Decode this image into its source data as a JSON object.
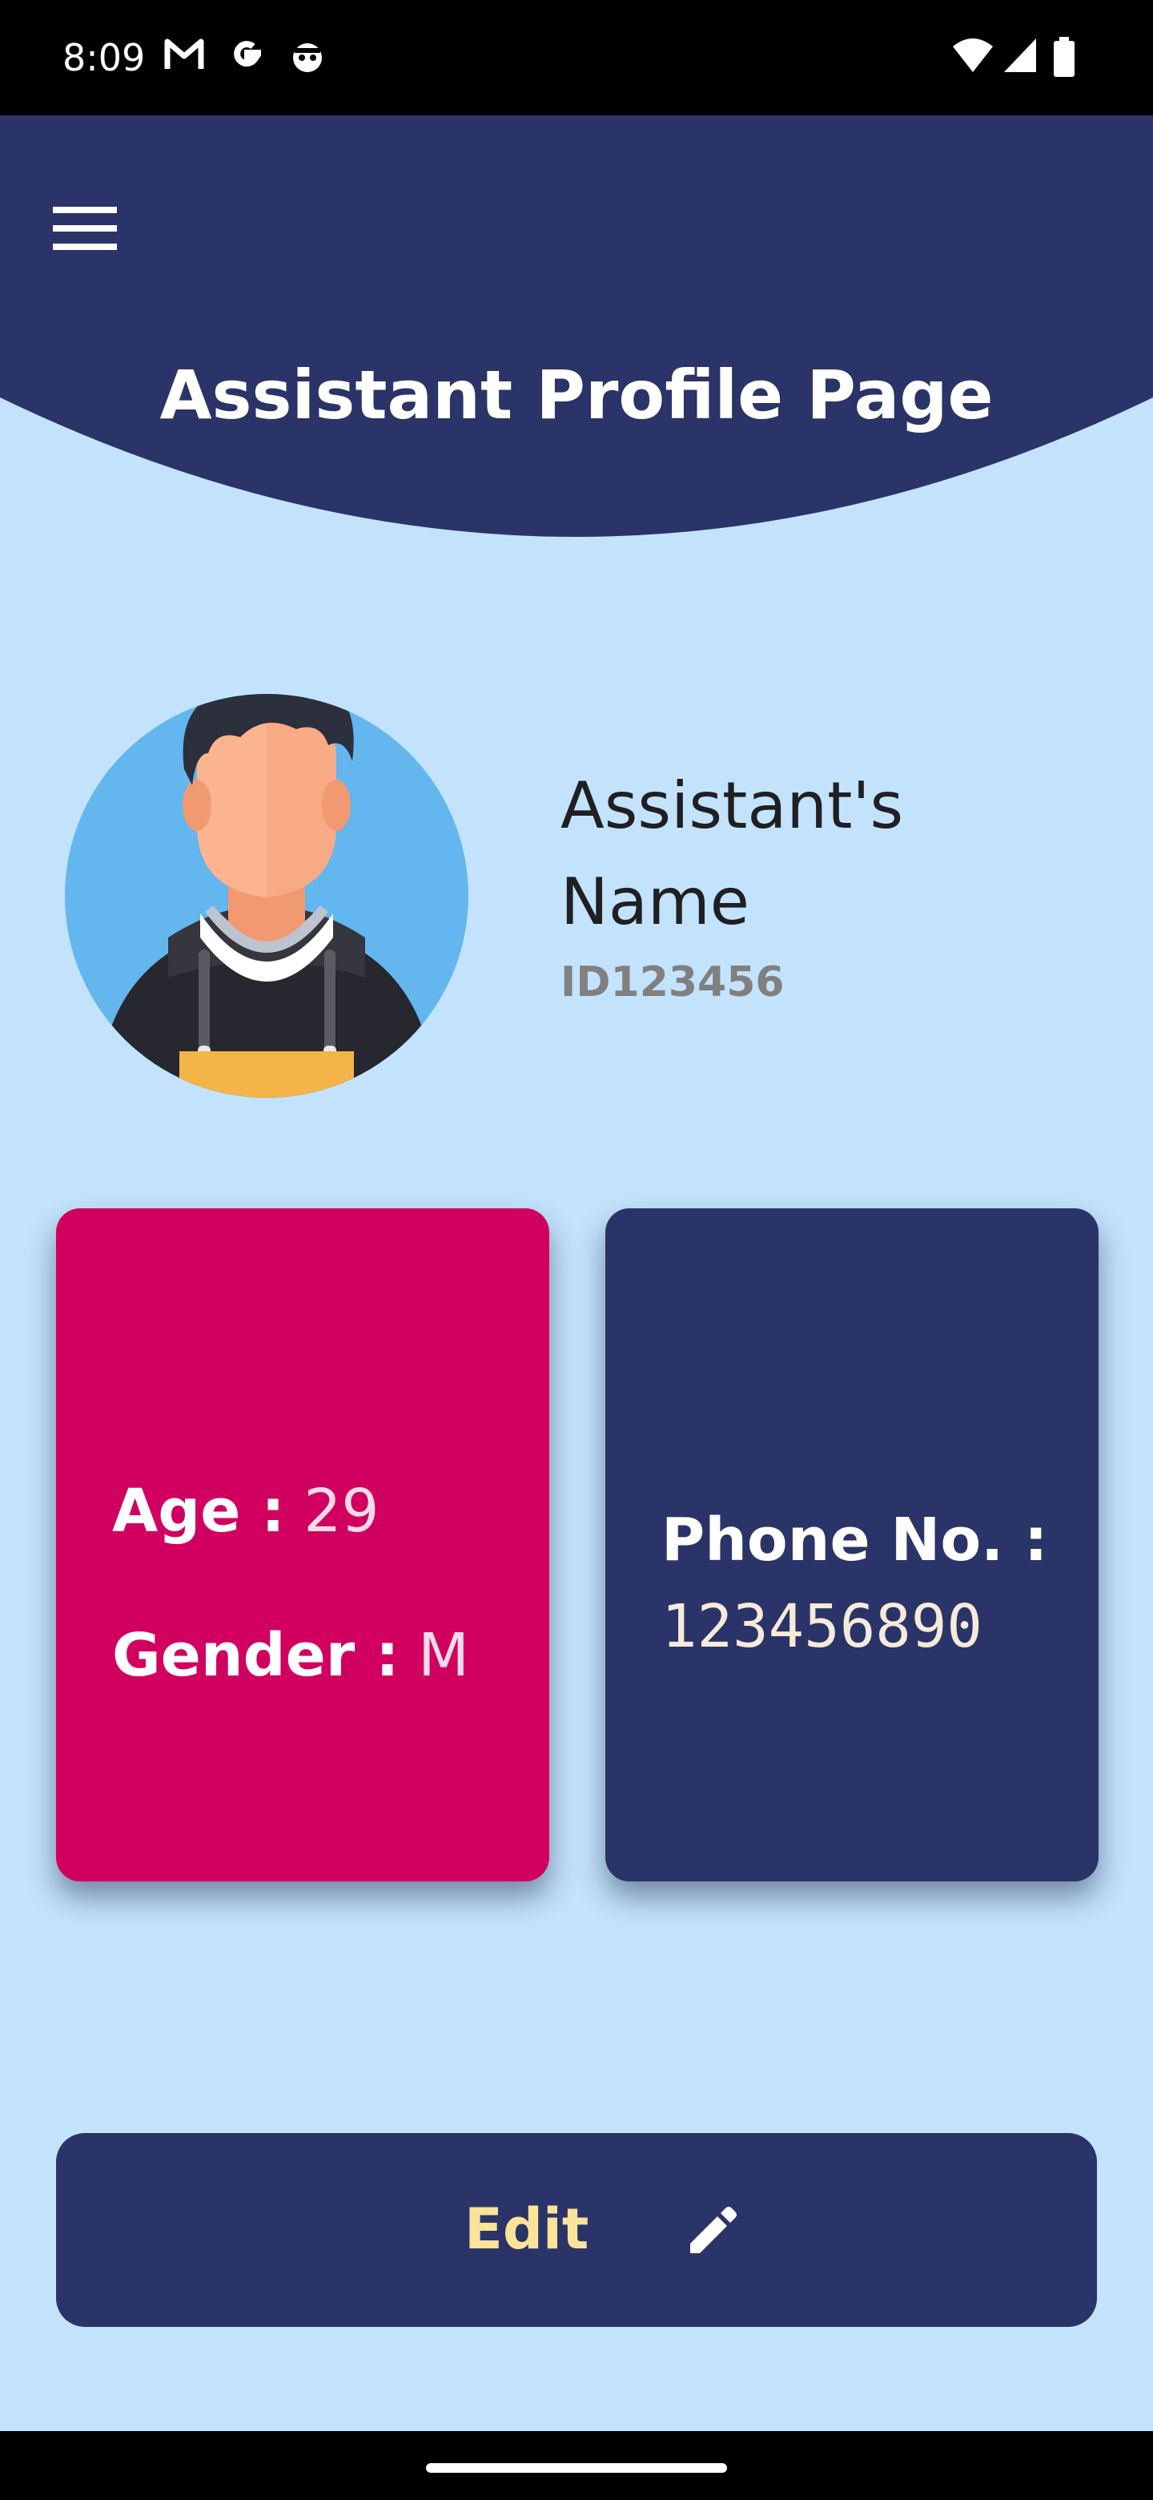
{
  "status_bar": {
    "time": "8:09",
    "left_icons": [
      "gmail-icon",
      "google-icon",
      "android-robot-icon"
    ],
    "right_icons": [
      "wifi-icon",
      "cell-signal-icon",
      "battery-icon"
    ]
  },
  "header": {
    "menu_icon": "hamburger-menu-icon",
    "title": "Assistant Profile Page"
  },
  "profile": {
    "avatar_icon": "person-avatar-icon",
    "name_line1": "Assistant's",
    "name_line2": "Name",
    "id": "ID123456"
  },
  "cards": {
    "personal": {
      "age_label": "Age :",
      "age_value": "29",
      "gender_label": "Gender :",
      "gender_value": "M"
    },
    "contact": {
      "phone_label": "Phone No. :",
      "phone_value": "123456890"
    }
  },
  "edit_button": {
    "label": "Edit",
    "icon": "pencil-icon"
  },
  "colors": {
    "background": "#c3e3fc",
    "navy": "#2b3468",
    "pink": "#d10060",
    "edit_label": "#fbe39a"
  }
}
